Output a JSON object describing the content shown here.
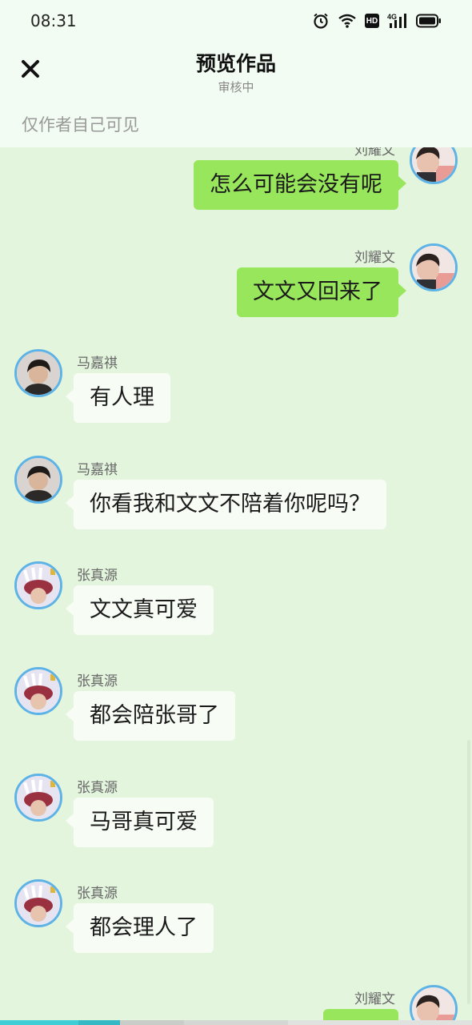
{
  "status_bar": {
    "time": "08:31",
    "icons": [
      "alarm-icon",
      "wifi-icon",
      "hd-icon",
      "signal-4g-icon",
      "battery-icon"
    ],
    "hd_label": "HD",
    "network_label": "4G"
  },
  "header": {
    "close_icon": "close-icon",
    "title": "预览作品",
    "subtitle": "审核中",
    "visibility_note": "仅作者自己可见"
  },
  "messages": [
    {
      "side": "right",
      "sender": "刘耀文",
      "text": "怎么可能会没有呢"
    },
    {
      "side": "right",
      "sender": "刘耀文",
      "text": "文文又回来了"
    },
    {
      "side": "left",
      "sender": "马嘉祺",
      "text": "有人理"
    },
    {
      "side": "left",
      "sender": "马嘉祺",
      "text": "你看我和文文不陪着你呢吗？"
    },
    {
      "side": "left",
      "sender": "张真源",
      "text": "文文真可爱"
    },
    {
      "side": "left",
      "sender": "张真源",
      "text": "都会陪张哥了"
    },
    {
      "side": "left",
      "sender": "张真源",
      "text": "马哥真可爱"
    },
    {
      "side": "left",
      "sender": "张真源",
      "text": "都会理人了"
    },
    {
      "side": "right",
      "sender": "刘耀文",
      "text": ""
    }
  ],
  "colors": {
    "chat_background": "#e4f5de",
    "header_background": "#f3fcf2",
    "outgoing_bubble": "#98e65b",
    "incoming_bubble": "#f7fcf5",
    "avatar_ring": "#5eb3e6"
  }
}
